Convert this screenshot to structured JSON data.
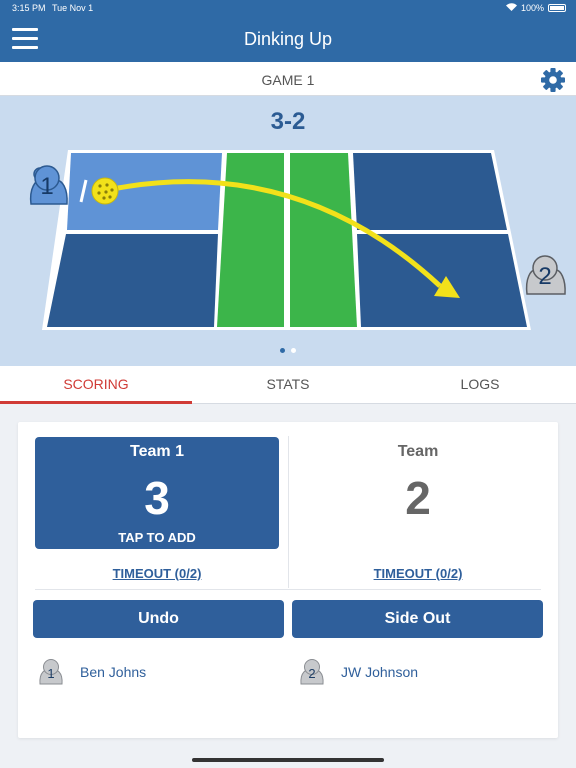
{
  "status": {
    "time": "3:15 PM",
    "date": "Tue Nov 1",
    "battery": "100%"
  },
  "nav": {
    "title": "Dinking Up"
  },
  "game": {
    "title": "GAME 1"
  },
  "court": {
    "score": "3-2",
    "player1_number": "1",
    "player2_number": "2"
  },
  "tabs": [
    {
      "label": "SCORING",
      "active": true
    },
    {
      "label": "STATS",
      "active": false
    },
    {
      "label": "LOGS",
      "active": false
    }
  ],
  "scoring": {
    "team1": {
      "name": "Team 1",
      "score": "3",
      "action": "TAP TO ADD",
      "timeout": "TIMEOUT (0/2)"
    },
    "team2": {
      "name": "Team",
      "score": "2",
      "timeout": "TIMEOUT (0/2)"
    },
    "undo_label": "Undo",
    "sideout_label": "Side Out",
    "players": [
      {
        "number": "1",
        "name": "Ben Johns"
      },
      {
        "number": "2",
        "name": "JW Johnson"
      }
    ]
  },
  "colors": {
    "primary": "#2f6aa6",
    "accent": "#d03b36",
    "court_dark": "#2c5a91",
    "court_light": "#5f93d6",
    "kitchen": "#3cb54a",
    "ball": "#f2e11a"
  }
}
